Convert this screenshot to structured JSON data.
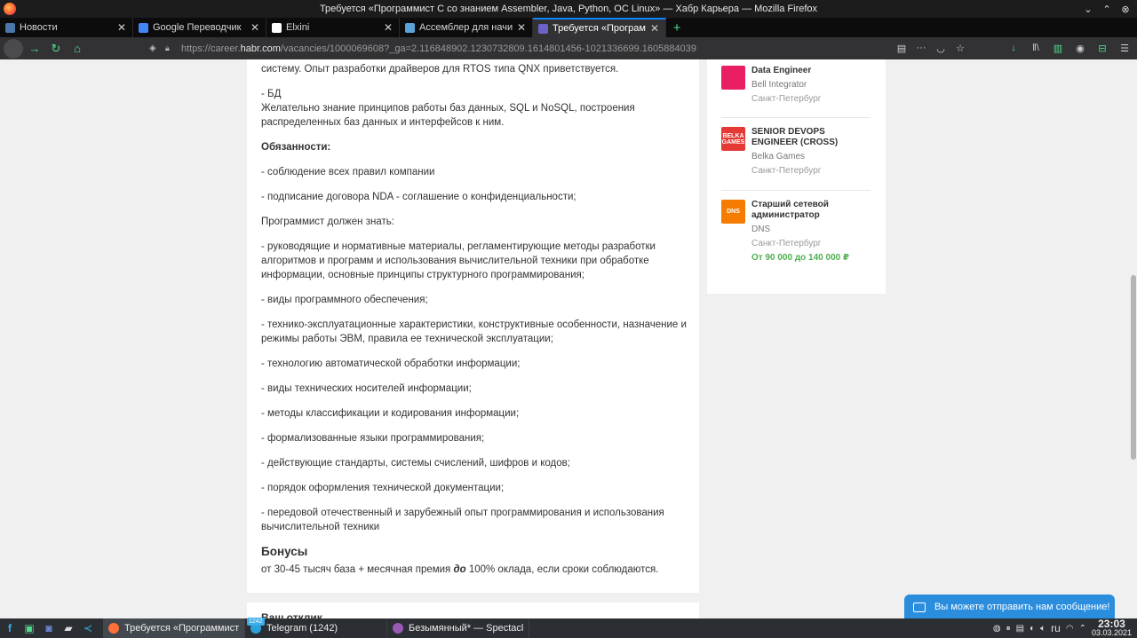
{
  "window": {
    "title": "Требуется «Программист С со знанием Assembler, Java, Python, ОС Linux» — Хабр Карьера — Mozilla Firefox"
  },
  "tabs": [
    {
      "label": "Новости",
      "color": "#4a76a8"
    },
    {
      "label": "Google Переводчик",
      "color": "#4285f4"
    },
    {
      "label": "Elxini",
      "color": "#ffffff"
    },
    {
      "label": "Ассемблер для начина",
      "color": "#5aa3d8"
    },
    {
      "label": "Требуется «Программ",
      "color": "#6c63c9",
      "active": true
    }
  ],
  "url": {
    "prefix": "https://career.",
    "host": "habr.com",
    "path": "/vacancies/1000069608?_ga=2.116848902.1230732809.1614801456-1021336699.1605884039"
  },
  "content": {
    "paragraphs": [
      "систему. Опыт разработки драйверов для RTOS типа QNX приветствуется.",
      "- БД\nЖелательно знание принципов работы баз данных, SQL и NoSQL, построения распределенных баз данных и интерфейсов к ним."
    ],
    "duties_heading": "Обязанности:",
    "duties": [
      "- соблюдение всех правил компании",
      "- подписание договора NDA - соглашение о конфиденциальности;"
    ],
    "know_heading": "Программист должен знать:",
    "know": [
      "- руководящие и нормативные материалы, регламентирующие методы разработки алгоритмов и программ и использования вычислительной техники при обработке информации, основные принципы структурного программирования;",
      "- виды программного обеспечения;",
      "- технико-эксплуатационные характеристики, конструктивные особенности, назначение и режимы работы ЭВМ, правила ее технической эксплуатации;",
      "- технологию автоматической обработки информации;",
      "- виды технических носителей информации;",
      "- методы классификации и кодирования информации;",
      "- формализованные языки программирования;",
      "- действующие стандарты, системы счислений, шифров и кодов;",
      "- порядок оформления технической документации;",
      "- передовой отечественный и зарубежный опыт программирования и использования вычислительной техники"
    ],
    "bonus_heading": "Бонусы",
    "bonus_text_1": "от 30-45 тысяч база + месячная премия ",
    "bonus_text_em": "до",
    "bonus_text_2": " 100% оклада, если сроки соблюдаются.",
    "next_heading": "Ваш отклик"
  },
  "sidebar": {
    "jobs": [
      {
        "title": "Data Engineer",
        "company": "Bell Integrator",
        "city": "Санкт-Петербург",
        "logo_color": "#e91e63",
        "logo_text": ""
      },
      {
        "title": "SENIOR DEVOPS ENGINEER (CROSS)",
        "company": "Belka Games",
        "city": "Санкт-Петербург",
        "logo_color": "#e53935",
        "logo_text": "BELKA GAMES"
      },
      {
        "title": "Старший сетевой администратор",
        "company": "DNS",
        "city": "Санкт-Петербург",
        "salary": "От 90 000 до 140 000 ₽",
        "logo_color": "#f57c00",
        "logo_text": "DNS"
      }
    ]
  },
  "chat": {
    "label": "Вы можете отправить нам сообщение!"
  },
  "taskbar": {
    "tasks": [
      {
        "label": "Требуется «Программист С...",
        "color": "#ff7139",
        "active": true
      },
      {
        "label": "Telegram (1242)",
        "color": "#2aa3dd",
        "badge": "1242"
      },
      {
        "label": "Безымянный* — Spectacle",
        "color": "#9b59b6"
      }
    ],
    "lang": "ru",
    "time": "23:03",
    "date": "03.03.2021"
  }
}
